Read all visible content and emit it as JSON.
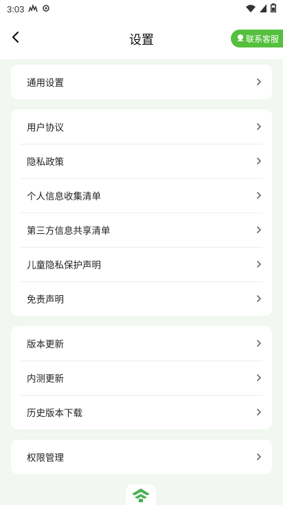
{
  "status_bar": {
    "time": "3:03",
    "icons": [
      "signal-icon",
      "settings-icon",
      "wifi-icon",
      "cellular-icon",
      "battery-icon"
    ]
  },
  "header": {
    "title": "设置",
    "contact_label": "联系客服"
  },
  "groups": [
    {
      "items": [
        {
          "label": "通用设置"
        }
      ]
    },
    {
      "items": [
        {
          "label": "用户协议"
        },
        {
          "label": "隐私政策"
        },
        {
          "label": "个人信息收集清单"
        },
        {
          "label": "第三方信息共享清单"
        },
        {
          "label": "儿童隐私保护声明"
        },
        {
          "label": "免责声明"
        }
      ]
    },
    {
      "items": [
        {
          "label": "版本更新"
        },
        {
          "label": "内测更新"
        },
        {
          "label": "历史版本下载"
        }
      ]
    },
    {
      "items": [
        {
          "label": "权限管理"
        }
      ]
    }
  ],
  "colors": {
    "accent": "#54c03d",
    "background": "#f2f7f1",
    "card": "#ffffff"
  }
}
